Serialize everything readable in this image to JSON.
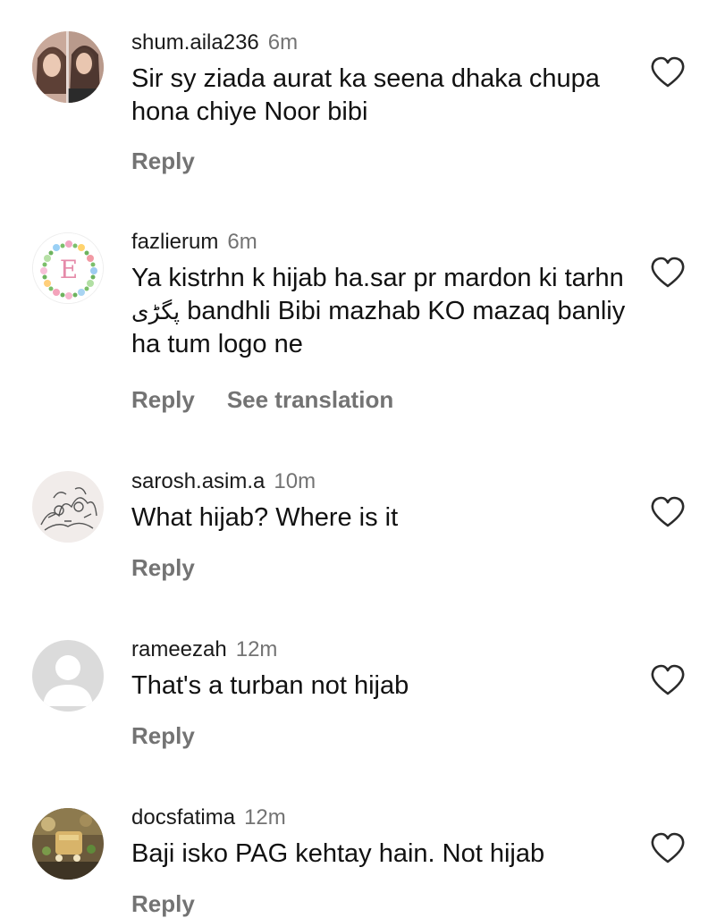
{
  "comments": [
    {
      "username": "shum.aila236",
      "time": "6m",
      "text": "Sir sy ziada aurat ka seena dhaka chupa hona chiye Noor bibi",
      "reply_label": "Reply",
      "avatar": "photo-avatar"
    },
    {
      "username": "fazlierum",
      "time": "6m",
      "text_before": "Ya kistrhn k hijab ha.sar pr mardon ki tarhn ",
      "text_urdu": "پگڑی",
      "text_after": " bandhli Bibi mazhab KO mazaq banliy ha tum logo ne",
      "reply_label": "Reply",
      "translation_label": "See translation",
      "avatar": "floral-letter-avatar",
      "avatar_letter": "E"
    },
    {
      "username": "sarosh.asim.a",
      "time": "10m",
      "text": "What hijab? Where is it",
      "reply_label": "Reply",
      "avatar": "sketch-avatar"
    },
    {
      "username": "rameezah",
      "time": "12m",
      "text": "That's a turban not hijab",
      "reply_label": "Reply",
      "avatar": "default-avatar"
    },
    {
      "username": "docsfatima",
      "time": "12m",
      "text": "Baji isko PAG kehtay hain. Not hijab",
      "reply_label": "Reply",
      "avatar": "photo-avatar"
    }
  ],
  "colors": {
    "text": "#111111",
    "secondary": "#737373",
    "background": "#ffffff"
  },
  "icons": {
    "like": "heart-outline-icon"
  }
}
